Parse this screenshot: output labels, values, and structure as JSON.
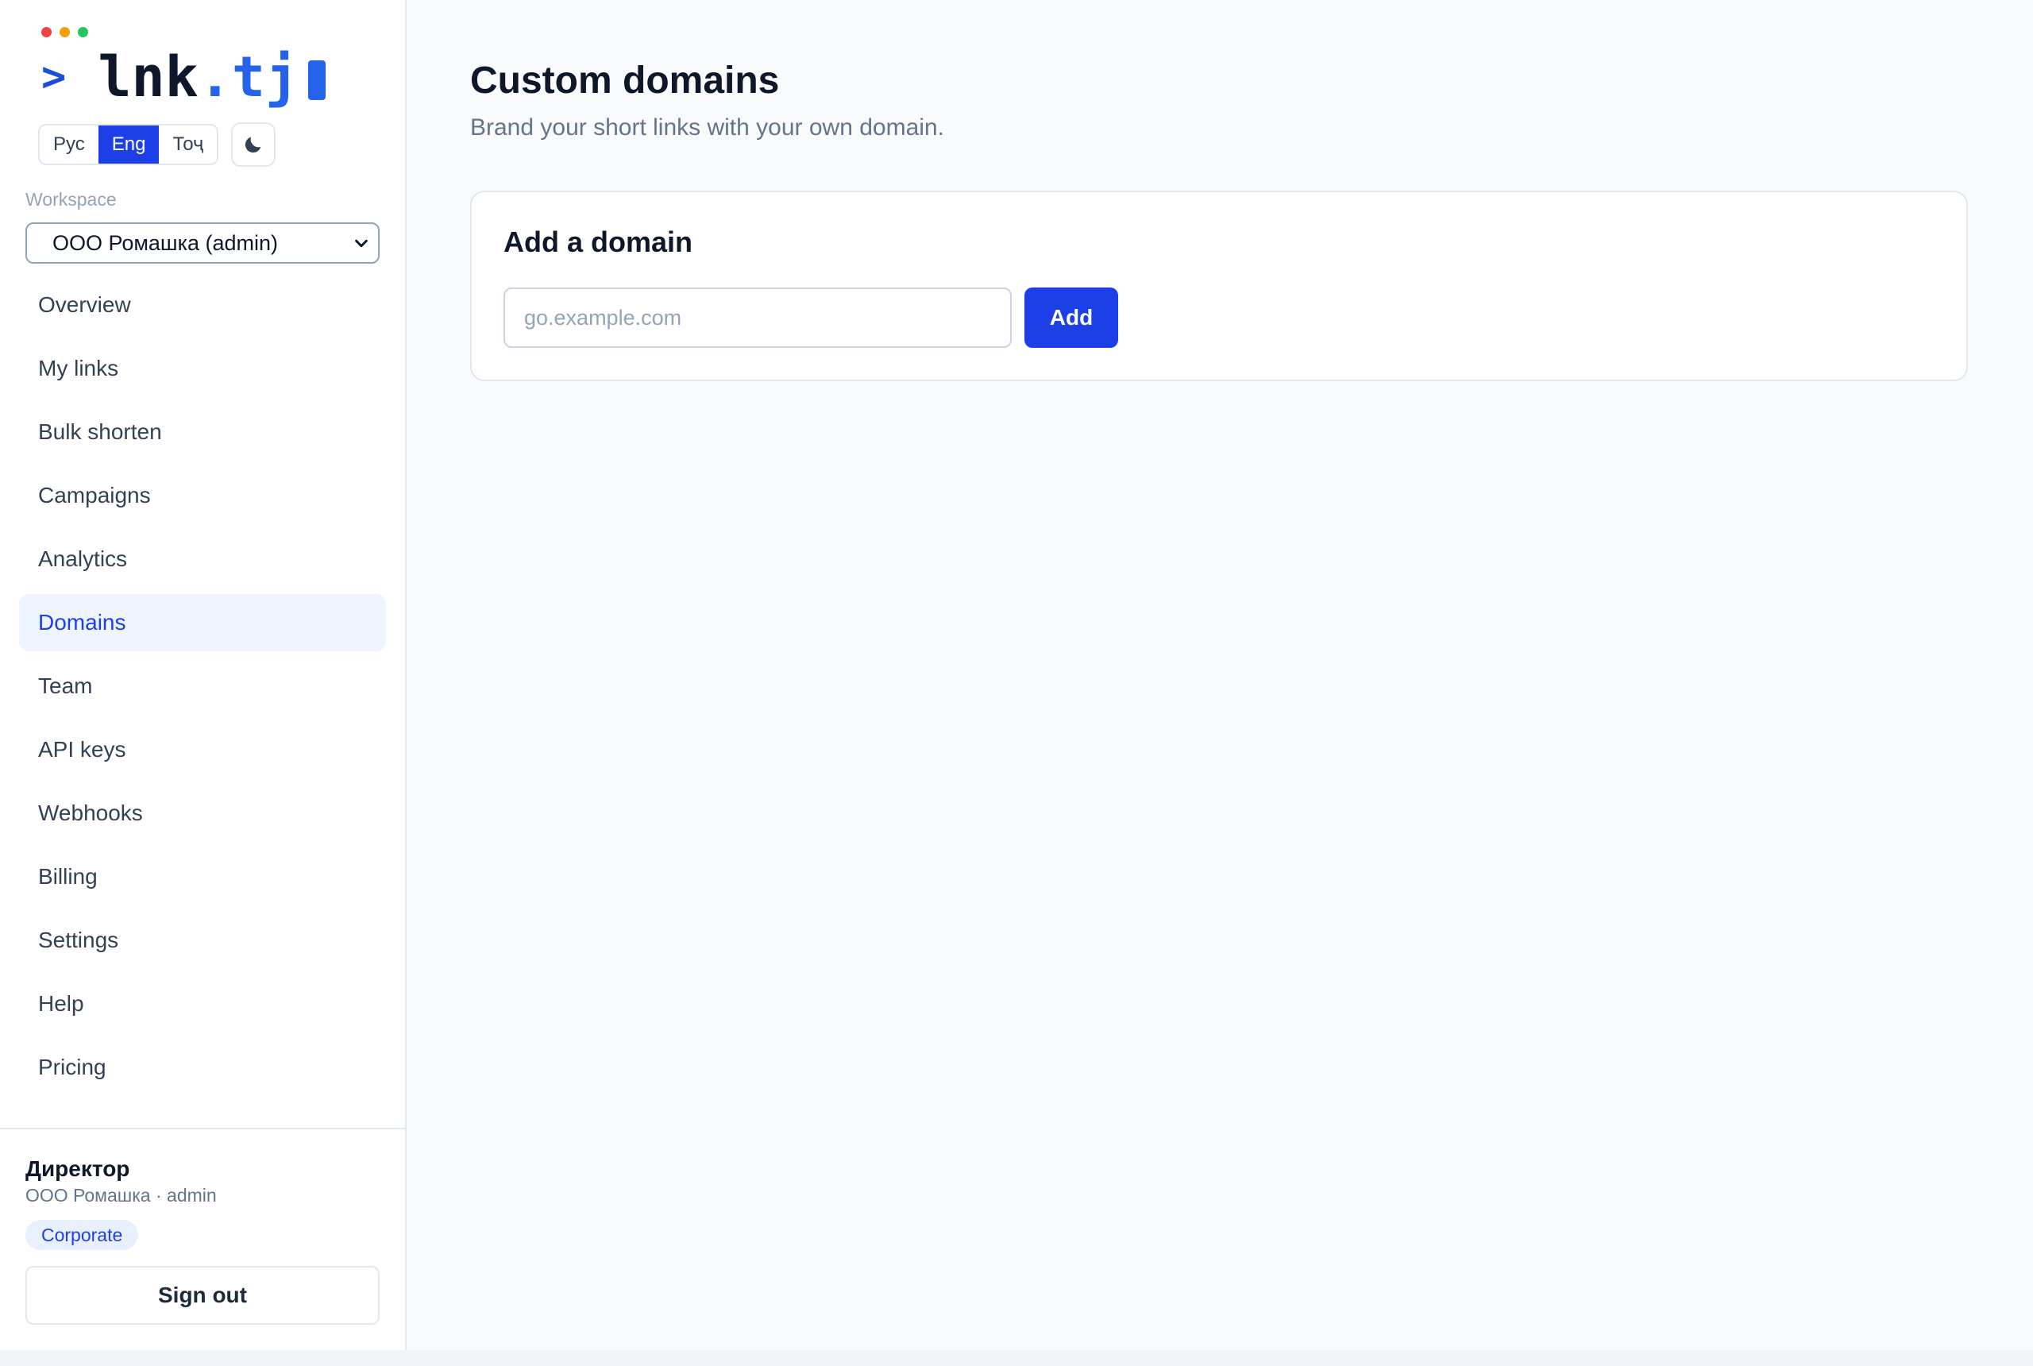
{
  "brand": {
    "logo_prompt": ">",
    "logo_name": "lnk",
    "logo_dot": ".",
    "logo_tld": "tj",
    "traffic_colors": [
      "#ef4444",
      "#f59e0b",
      "#22c55e"
    ],
    "accent_color": "#1d3fe8"
  },
  "language": {
    "options": [
      "Рус",
      "Eng",
      "Тоҷ"
    ],
    "selected": "Eng"
  },
  "theme_toggle": {
    "icon": "moon-icon"
  },
  "workspace": {
    "label": "Workspace",
    "selected": "ООО Ромашка (admin)"
  },
  "nav": {
    "items": [
      {
        "label": "Overview"
      },
      {
        "label": "My links"
      },
      {
        "label": "Bulk shorten"
      },
      {
        "label": "Campaigns"
      },
      {
        "label": "Analytics"
      },
      {
        "label": "Domains",
        "active": true
      },
      {
        "label": "Team"
      },
      {
        "label": "API keys"
      },
      {
        "label": "Webhooks"
      },
      {
        "label": "Billing"
      },
      {
        "label": "Settings"
      },
      {
        "label": "Help"
      },
      {
        "label": "Pricing"
      }
    ]
  },
  "user": {
    "name": "Директор",
    "meta": "ООО Ромашка · admin",
    "plan": "Corporate",
    "signout_label": "Sign out"
  },
  "page": {
    "title": "Custom domains",
    "subtitle": "Brand your short links with your own domain."
  },
  "add_domain": {
    "title": "Add a domain",
    "input_placeholder": "go.example.com",
    "input_value": "",
    "button_label": "Add"
  }
}
